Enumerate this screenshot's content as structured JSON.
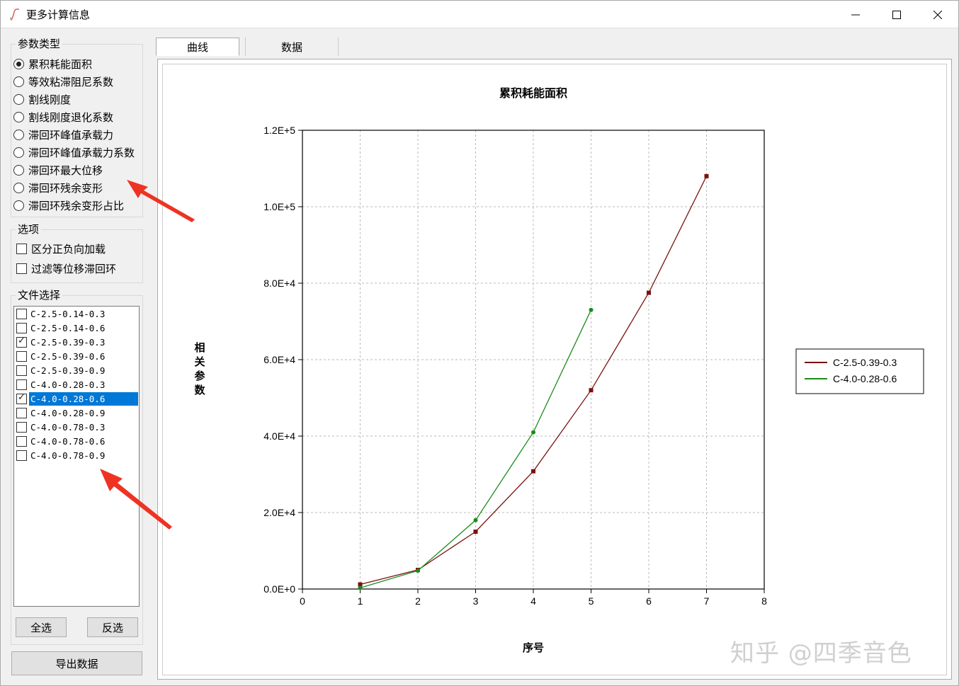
{
  "window": {
    "title": "更多计算信息"
  },
  "param_group": {
    "title": "参数类型",
    "options": [
      "累积耗能面积",
      "等效粘滞阻尼系数",
      "割线刚度",
      "割线刚度退化系数",
      "滞回环峰值承载力",
      "滞回环峰值承载力系数",
      "滞回环最大位移",
      "滞回环残余变形",
      "滞回环残余变形占比"
    ],
    "selected_index": 0
  },
  "options_group": {
    "title": "选项",
    "items": [
      {
        "label": "区分正负向加载",
        "checked": false
      },
      {
        "label": "过滤等位移滞回环",
        "checked": false
      }
    ]
  },
  "files_group": {
    "title": "文件选择",
    "files": [
      {
        "label": "C-2.5-0.14-0.3",
        "checked": false
      },
      {
        "label": "C-2.5-0.14-0.6",
        "checked": false
      },
      {
        "label": "C-2.5-0.39-0.3",
        "checked": true
      },
      {
        "label": "C-2.5-0.39-0.6",
        "checked": false
      },
      {
        "label": "C-2.5-0.39-0.9",
        "checked": false
      },
      {
        "label": "C-4.0-0.28-0.3",
        "checked": false
      },
      {
        "label": "C-4.0-0.28-0.6",
        "checked": true,
        "selected": true
      },
      {
        "label": "C-4.0-0.28-0.9",
        "checked": false
      },
      {
        "label": "C-4.0-0.78-0.3",
        "checked": false
      },
      {
        "label": "C-4.0-0.78-0.6",
        "checked": false
      },
      {
        "label": "C-4.0-0.78-0.9",
        "checked": false
      }
    ],
    "select_all_label": "全选",
    "invert_label": "反选"
  },
  "export_label": "导出数据",
  "tabs": [
    {
      "label": "曲线",
      "active": true
    },
    {
      "label": "数据",
      "active": false
    }
  ],
  "watermark": "知乎 @四季音色",
  "chart_data": {
    "type": "line",
    "title": "累积耗能面积",
    "xlabel": "序号",
    "ylabel": "相关参数",
    "xlim": [
      0,
      8
    ],
    "ylim": [
      0,
      120000
    ],
    "x_ticks": [
      "0",
      "1",
      "2",
      "3",
      "4",
      "5",
      "6",
      "7",
      "8"
    ],
    "y_ticks": [
      "0.0E+0",
      "2.0E+4",
      "4.0E+4",
      "6.0E+4",
      "8.0E+4",
      "1.0E+5",
      "1.2E+5"
    ],
    "grid": true,
    "legend_position": "right",
    "series": [
      {
        "name": "C-2.5-0.39-0.3",
        "color": "#7b1010",
        "marker": "square",
        "x": [
          1,
          2,
          3,
          4,
          5,
          6,
          7
        ],
        "y": [
          1200,
          5000,
          15000,
          30800,
          52000,
          77500,
          108000
        ]
      },
      {
        "name": "C-4.0-0.28-0.6",
        "color": "#1a8c1a",
        "marker": "circle",
        "x": [
          1,
          2,
          3,
          4,
          5
        ],
        "y": [
          300,
          4800,
          18000,
          41000,
          73000
        ]
      }
    ]
  }
}
